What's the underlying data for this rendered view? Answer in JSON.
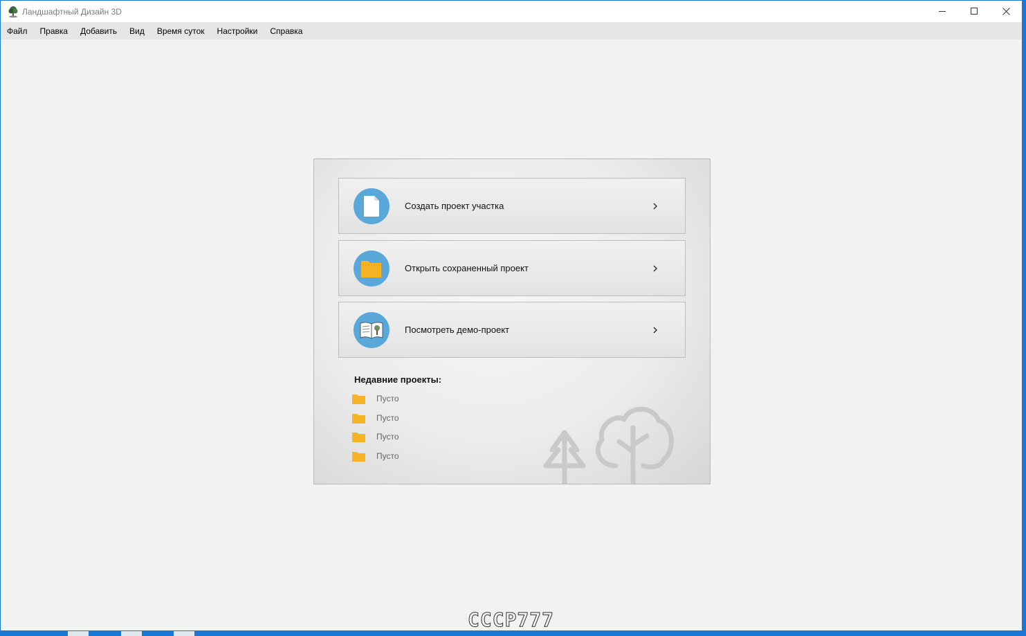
{
  "window": {
    "title": "Ландшафтный Дизайн 3D"
  },
  "menu": [
    "Файл",
    "Правка",
    "Добавить",
    "Вид",
    "Время суток",
    "Настройки",
    "Справка"
  ],
  "actions": [
    {
      "label": "Создать проект участка",
      "icon": "new-document-icon"
    },
    {
      "label": "Открыть сохраненный проект",
      "icon": "open-folder-icon"
    },
    {
      "label": "Посмотреть демо-проект",
      "icon": "demo-book-icon"
    }
  ],
  "recent": {
    "title": "Недавние проекты:",
    "items": [
      "Пусто",
      "Пусто",
      "Пусто",
      "Пусто"
    ]
  },
  "watermark": "СССР777",
  "colors": {
    "accent": "#5aa8da",
    "folder": "#f5b325",
    "titlebar_text": "#7a7a7a"
  }
}
